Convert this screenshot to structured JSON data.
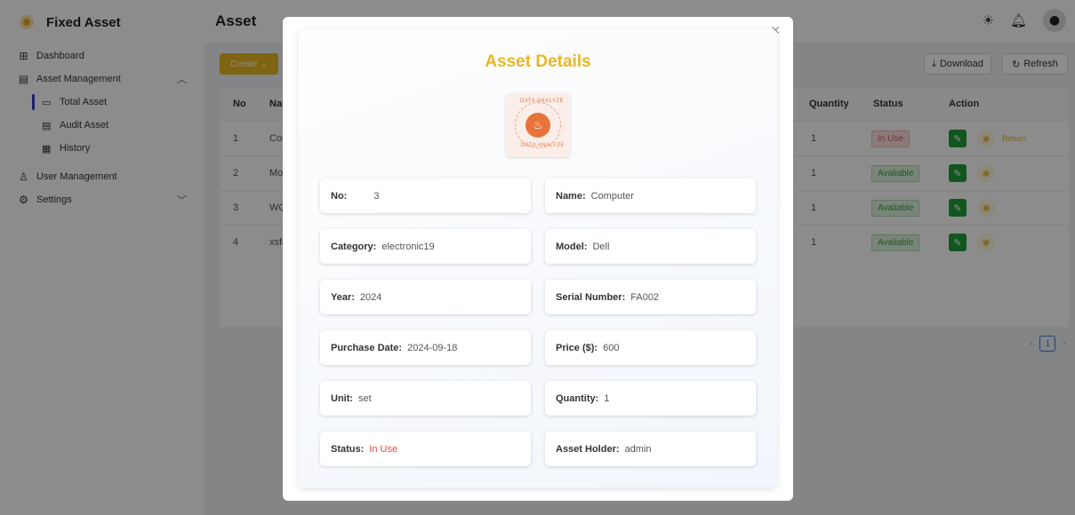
{
  "app": {
    "title": "Fixed Asset"
  },
  "sidebar": {
    "items": [
      {
        "label": "Dashboard",
        "icon": "grid-icon"
      },
      {
        "label": "Asset Management",
        "icon": "file-icon"
      },
      {
        "label": "User Management",
        "icon": "user-icon"
      },
      {
        "label": "Settings",
        "icon": "gear-icon"
      }
    ],
    "sub_items": [
      {
        "label": "Total Asset"
      },
      {
        "label": "Audit Asset"
      },
      {
        "label": "History"
      }
    ]
  },
  "header": {
    "title": "Asset"
  },
  "toolbar": {
    "create_label": "Create",
    "download_label": "Download",
    "refresh_label": "Refresh"
  },
  "table": {
    "columns": [
      "No",
      "Nar",
      "Quantity",
      "Status",
      "Action"
    ],
    "rows": [
      {
        "no": "1",
        "name": "Con",
        "quantity": "1",
        "status": "In Use",
        "return": "Return"
      },
      {
        "no": "2",
        "name": "Mou",
        "quantity": "1",
        "status": "Avaliable"
      },
      {
        "no": "3",
        "name": "WQI",
        "quantity": "1",
        "status": "Avaliable"
      },
      {
        "no": "4",
        "name": "xsfd",
        "quantity": "1",
        "status": "Avaliable"
      }
    ]
  },
  "pagination": {
    "current": "1"
  },
  "modal": {
    "title": "Asset Details",
    "logo_text_top": "DATA ANALYZE",
    "logo_text_bottom": "DATA ANALYZE",
    "fields": {
      "no_label": "No:",
      "no_value": "3",
      "name_label": "Name:",
      "name_value": "Computer",
      "category_label": "Category:",
      "category_value": "electronic19",
      "model_label": "Model:",
      "model_value": "Dell",
      "year_label": "Year:",
      "year_value": "2024",
      "serial_label": "Serial Number:",
      "serial_value": "FA002",
      "purchase_label": "Purchase Date:",
      "purchase_value": "2024-09-18",
      "price_label": "Price ($):",
      "price_value": "600",
      "unit_label": "Unit:",
      "unit_value": "set",
      "quantity_label": "Quantity:",
      "quantity_value": "1",
      "status_label": "Status:",
      "status_value": "In Use",
      "holder_label": "Asset Holder:",
      "holder_value": "admin"
    }
  },
  "colors": {
    "accent": "#e8b724",
    "in_use": "#e04848",
    "available": "#3c9b3c",
    "edit": "#1f9d3a"
  }
}
